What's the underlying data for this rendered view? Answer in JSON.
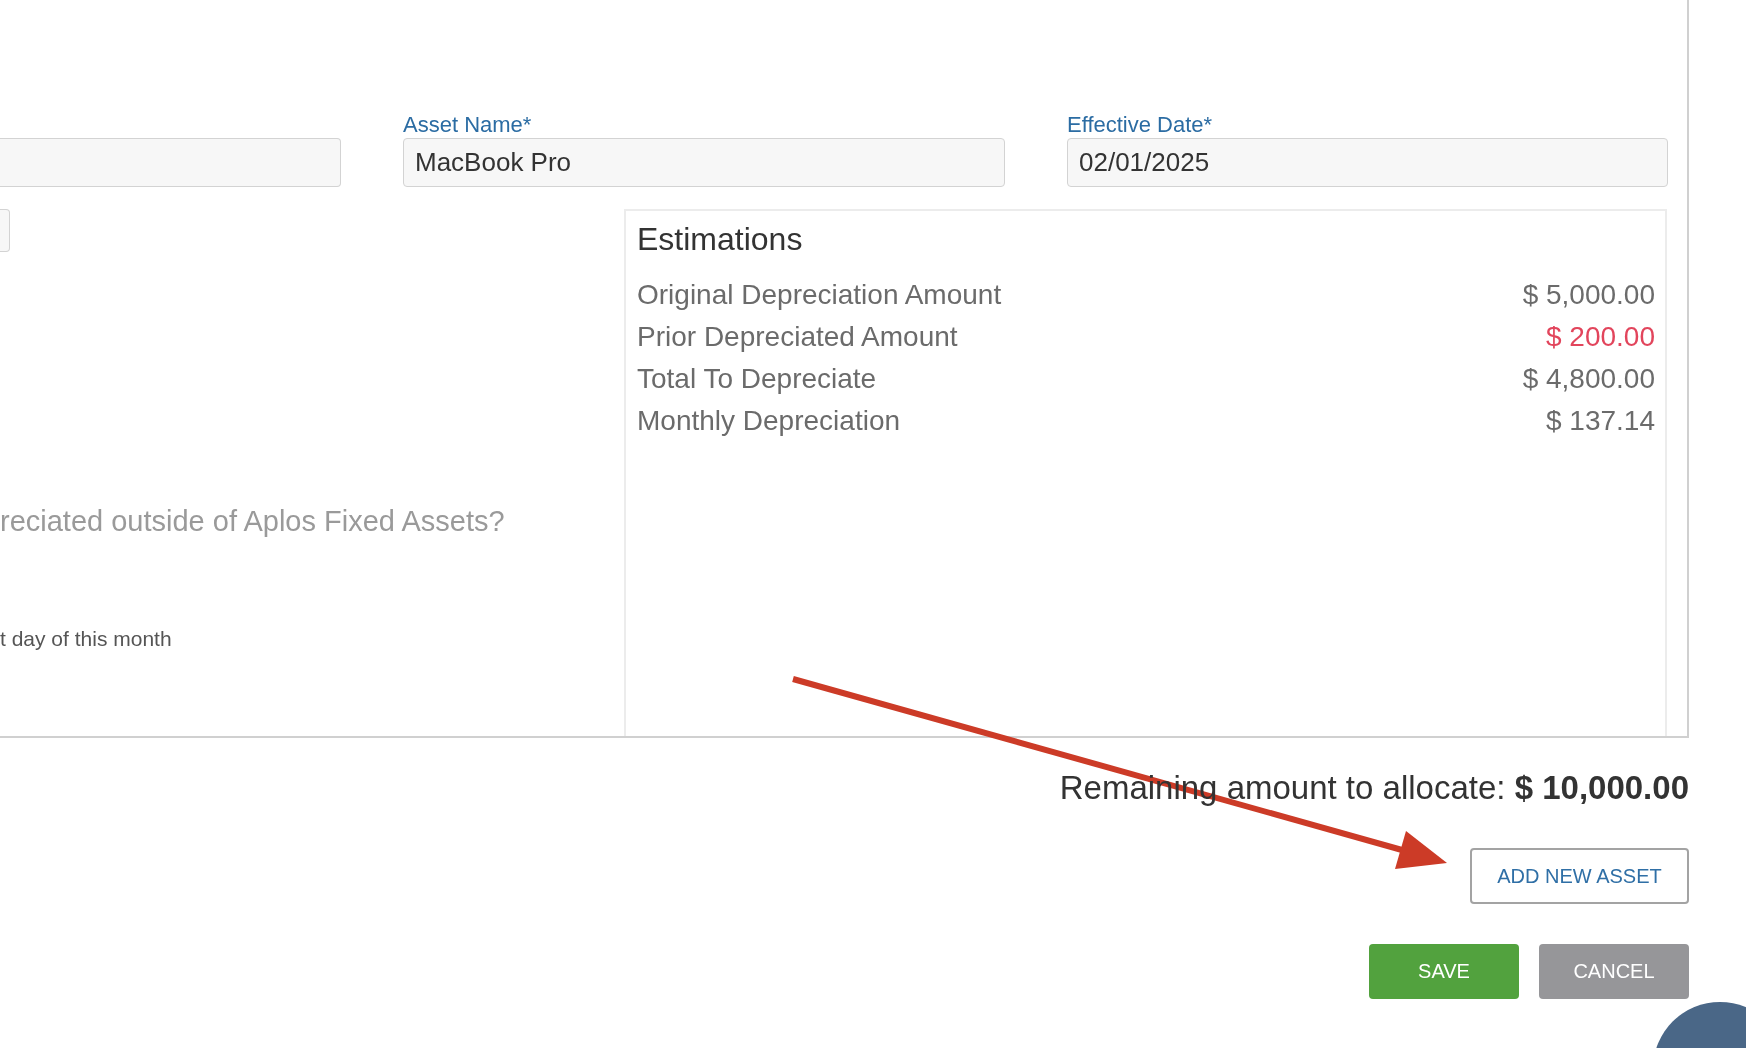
{
  "asset_fields": [
    {
      "label": "Asset Name*",
      "value": "MacBook Pro"
    },
    {
      "label": "Effective Date*",
      "value": "02/01/2025"
    }
  ],
  "question": "reciated outside of Aplos Fixed Assets?",
  "note": "t day of this month",
  "estimations": {
    "title": "Estimations",
    "rows": [
      {
        "label": "Original Depreciation Amount",
        "value": "$ 5,000.00",
        "color": "#6b6b6b"
      },
      {
        "label": "Prior Depreciated Amount",
        "value": "$ 200.00",
        "color": "#e2455c"
      },
      {
        "label": "Total To Depreciate",
        "value": "$ 4,800.00",
        "color": "#6b6b6b"
      },
      {
        "label": "Monthly Depreciation",
        "value": "$ 137.14",
        "color": "#6b6b6b"
      }
    ]
  },
  "remaining": "Remaining amount to allocate: **$ 10,000.00**",
  "add_button": "ADD NEW ASSET",
  "actions": [
    {
      "label": "SAVE",
      "kind": "primary"
    },
    {
      "label": "CANCEL",
      "kind": "secondary"
    }
  ]
}
